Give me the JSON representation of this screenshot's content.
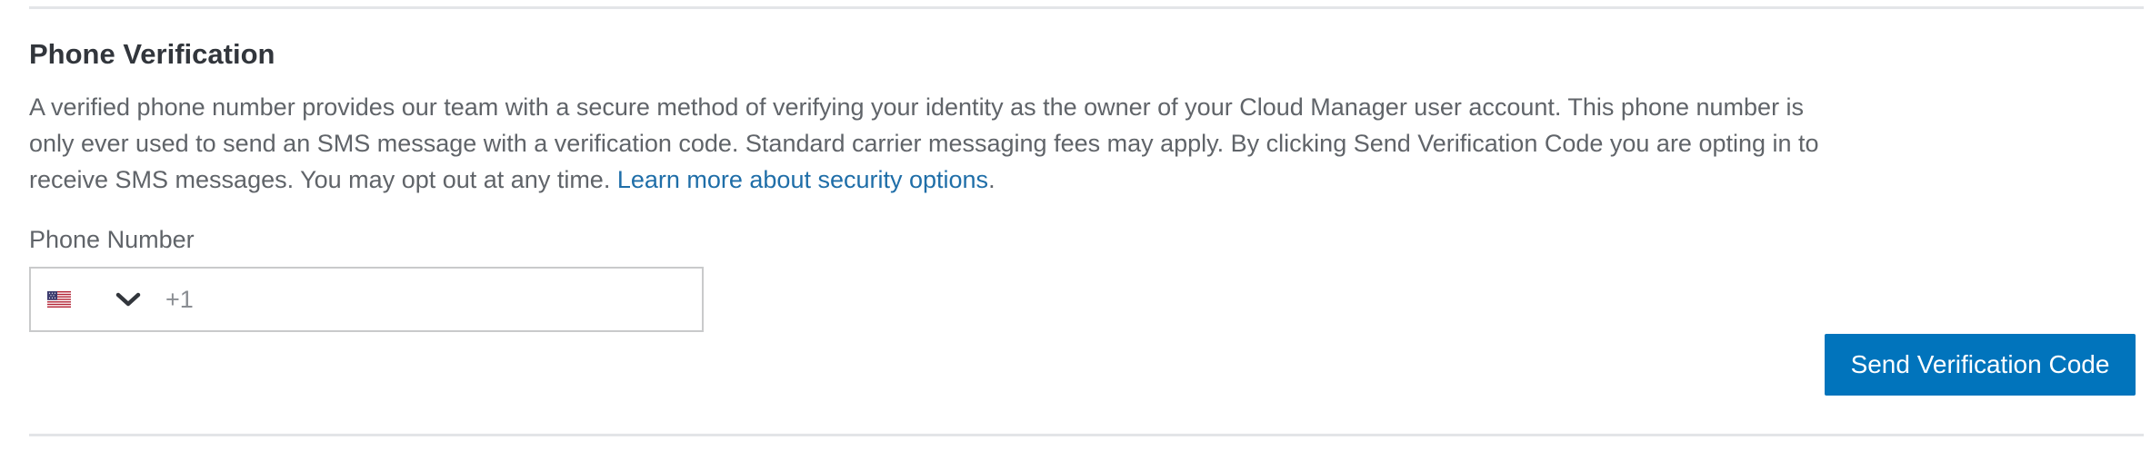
{
  "section": {
    "title": "Phone Verification",
    "description_text": "A verified phone number provides our team with a secure method of verifying your identity as the owner of your Cloud Manager user account. This phone number is only ever used to send an SMS message with a verification code. Standard carrier messaging fees may apply. By clicking Send Verification Code you are opting in to receive SMS messages. You may opt out at any time. ",
    "learn_more_link": "Learn more about security options",
    "description_end": "."
  },
  "phone_field": {
    "label": "Phone Number",
    "country_flag_icon": "us-flag-icon",
    "dropdown_icon": "chevron-down-icon",
    "dial_code": "+1",
    "value": "",
    "placeholder": ""
  },
  "actions": {
    "send_label": "Send Verification Code"
  },
  "colors": {
    "primary": "#0174bc",
    "link": "#1f6ea8",
    "text": "#32363c",
    "muted_text": "#606469",
    "border": "#c9cacb",
    "divider": "#e3e5e8"
  }
}
